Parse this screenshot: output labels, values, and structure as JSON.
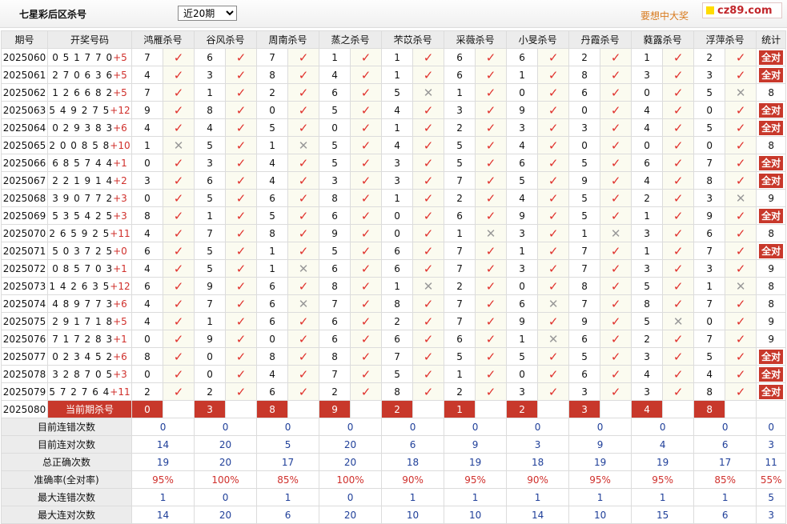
{
  "header": {
    "title": "七星彩后区杀号",
    "period_select": {
      "selected": "近20期",
      "options": [
        "近20期"
      ]
    },
    "slogan": "要想中大奖",
    "logo_text": "cz89.com"
  },
  "table": {
    "issue_header": "期号",
    "draw_header": "开奖号码",
    "summary_header": "统计",
    "experts": [
      "鸿雁杀号",
      "谷风杀号",
      "周南杀号",
      "蒸之杀号",
      "芣苡杀号",
      "采薇杀号",
      "小旻杀号",
      "丹霞杀号",
      "蕤露杀号",
      "浮萍杀号"
    ],
    "rows": [
      {
        "issue": "2025060",
        "draw": "051770",
        "plus": "+5",
        "kills": [
          7,
          6,
          7,
          1,
          1,
          6,
          6,
          2,
          1,
          2
        ],
        "hits": [
          1,
          1,
          1,
          1,
          1,
          1,
          1,
          1,
          1,
          1
        ],
        "summary": "全对"
      },
      {
        "issue": "2025061",
        "draw": "270636",
        "plus": "+5",
        "kills": [
          4,
          3,
          8,
          4,
          1,
          6,
          1,
          8,
          3,
          3
        ],
        "hits": [
          1,
          1,
          1,
          1,
          1,
          1,
          1,
          1,
          1,
          1
        ],
        "summary": "全对"
      },
      {
        "issue": "2025062",
        "draw": "126682",
        "plus": "+5",
        "kills": [
          7,
          1,
          2,
          6,
          5,
          1,
          0,
          6,
          0,
          5
        ],
        "hits": [
          1,
          1,
          1,
          1,
          0,
          1,
          1,
          1,
          1,
          0
        ],
        "summary": "8"
      },
      {
        "issue": "2025063",
        "draw": "549275",
        "plus": "+12",
        "kills": [
          9,
          8,
          0,
          5,
          4,
          3,
          9,
          0,
          4,
          0
        ],
        "hits": [
          1,
          1,
          1,
          1,
          1,
          1,
          1,
          1,
          1,
          1
        ],
        "summary": "全对"
      },
      {
        "issue": "2025064",
        "draw": "029383",
        "plus": "+6",
        "kills": [
          4,
          4,
          5,
          0,
          1,
          2,
          3,
          3,
          4,
          5
        ],
        "hits": [
          1,
          1,
          1,
          1,
          1,
          1,
          1,
          1,
          1,
          1
        ],
        "summary": "全对"
      },
      {
        "issue": "2025065",
        "draw": "200858",
        "plus": "+10",
        "kills": [
          1,
          5,
          1,
          5,
          4,
          5,
          4,
          0,
          0,
          0
        ],
        "hits": [
          0,
          1,
          0,
          1,
          1,
          1,
          1,
          1,
          1,
          1
        ],
        "summary": "8"
      },
      {
        "issue": "2025066",
        "draw": "685744",
        "plus": "+1",
        "kills": [
          0,
          3,
          4,
          5,
          3,
          5,
          6,
          5,
          6,
          7
        ],
        "hits": [
          1,
          1,
          1,
          1,
          1,
          1,
          1,
          1,
          1,
          1
        ],
        "summary": "全对"
      },
      {
        "issue": "2025067",
        "draw": "221914",
        "plus": "+2",
        "kills": [
          3,
          6,
          4,
          3,
          3,
          7,
          5,
          9,
          4,
          8
        ],
        "hits": [
          1,
          1,
          1,
          1,
          1,
          1,
          1,
          1,
          1,
          1
        ],
        "summary": "全对"
      },
      {
        "issue": "2025068",
        "draw": "390772",
        "plus": "+3",
        "kills": [
          0,
          5,
          6,
          8,
          1,
          2,
          4,
          5,
          2,
          3
        ],
        "hits": [
          1,
          1,
          1,
          1,
          1,
          1,
          1,
          1,
          1,
          0
        ],
        "summary": "9"
      },
      {
        "issue": "2025069",
        "draw": "535425",
        "plus": "+3",
        "kills": [
          8,
          1,
          5,
          6,
          0,
          6,
          9,
          5,
          1,
          9
        ],
        "hits": [
          1,
          1,
          1,
          1,
          1,
          1,
          1,
          1,
          1,
          1
        ],
        "summary": "全对"
      },
      {
        "issue": "2025070",
        "draw": "265925",
        "plus": "+11",
        "kills": [
          4,
          7,
          8,
          9,
          0,
          1,
          3,
          1,
          3,
          6
        ],
        "hits": [
          1,
          1,
          1,
          1,
          1,
          0,
          1,
          0,
          1,
          1
        ],
        "summary": "8"
      },
      {
        "issue": "2025071",
        "draw": "503725",
        "plus": "+0",
        "kills": [
          6,
          5,
          1,
          5,
          6,
          7,
          1,
          7,
          1,
          7
        ],
        "hits": [
          1,
          1,
          1,
          1,
          1,
          1,
          1,
          1,
          1,
          1
        ],
        "summary": "全对"
      },
      {
        "issue": "2025072",
        "draw": "085703",
        "plus": "+1",
        "kills": [
          4,
          5,
          1,
          6,
          6,
          7,
          3,
          7,
          3,
          3
        ],
        "hits": [
          1,
          1,
          0,
          1,
          1,
          1,
          1,
          1,
          1,
          1
        ],
        "summary": "9"
      },
      {
        "issue": "2025073",
        "draw": "142635",
        "plus": "+12",
        "kills": [
          6,
          9,
          6,
          8,
          1,
          2,
          0,
          8,
          5,
          1
        ],
        "hits": [
          1,
          1,
          1,
          1,
          0,
          1,
          1,
          1,
          1,
          0
        ],
        "summary": "8"
      },
      {
        "issue": "2025074",
        "draw": "489773",
        "plus": "+6",
        "kills": [
          4,
          7,
          6,
          7,
          8,
          7,
          6,
          7,
          8,
          7
        ],
        "hits": [
          1,
          1,
          0,
          1,
          1,
          1,
          0,
          1,
          1,
          1
        ],
        "summary": "8"
      },
      {
        "issue": "2025075",
        "draw": "291718",
        "plus": "+5",
        "kills": [
          4,
          1,
          6,
          6,
          2,
          7,
          9,
          9,
          5,
          0
        ],
        "hits": [
          1,
          1,
          1,
          1,
          1,
          1,
          1,
          1,
          0,
          1
        ],
        "summary": "9"
      },
      {
        "issue": "2025076",
        "draw": "717283",
        "plus": "+1",
        "kills": [
          0,
          9,
          0,
          6,
          6,
          6,
          1,
          6,
          2,
          7
        ],
        "hits": [
          1,
          1,
          1,
          1,
          1,
          1,
          0,
          1,
          1,
          1
        ],
        "summary": "9"
      },
      {
        "issue": "2025077",
        "draw": "023452",
        "plus": "+6",
        "kills": [
          8,
          0,
          8,
          8,
          7,
          5,
          5,
          5,
          3,
          5
        ],
        "hits": [
          1,
          1,
          1,
          1,
          1,
          1,
          1,
          1,
          1,
          1
        ],
        "summary": "全对"
      },
      {
        "issue": "2025078",
        "draw": "328705",
        "plus": "+3",
        "kills": [
          0,
          0,
          4,
          7,
          5,
          1,
          0,
          6,
          4,
          4
        ],
        "hits": [
          1,
          1,
          1,
          1,
          1,
          1,
          1,
          1,
          1,
          1
        ],
        "summary": "全对"
      },
      {
        "issue": "2025079",
        "draw": "572764",
        "plus": "+11",
        "kills": [
          2,
          2,
          6,
          2,
          8,
          2,
          3,
          3,
          3,
          8
        ],
        "hits": [
          1,
          1,
          1,
          1,
          1,
          1,
          1,
          1,
          1,
          1
        ],
        "summary": "全对"
      }
    ],
    "current": {
      "issue": "2025080",
      "label": "当前期杀号",
      "kills": [
        0,
        3,
        8,
        9,
        2,
        1,
        2,
        3,
        4,
        8
      ]
    },
    "stats": [
      {
        "label": "目前连错次数",
        "values": [
          "0",
          "0",
          "0",
          "0",
          "0",
          "0",
          "0",
          "0",
          "0",
          "0"
        ],
        "summary": "0",
        "color": "blue"
      },
      {
        "label": "目前连对次数",
        "values": [
          "14",
          "20",
          "5",
          "20",
          "6",
          "9",
          "3",
          "9",
          "4",
          "6"
        ],
        "summary": "3",
        "color": "blue"
      },
      {
        "label": "总正确次数",
        "values": [
          "19",
          "20",
          "17",
          "20",
          "18",
          "19",
          "18",
          "19",
          "19",
          "17"
        ],
        "summary": "11",
        "color": "blue"
      },
      {
        "label": "准确率(全对率)",
        "values": [
          "95%",
          "100%",
          "85%",
          "100%",
          "90%",
          "95%",
          "90%",
          "95%",
          "95%",
          "85%"
        ],
        "summary": "55%",
        "color": "red"
      },
      {
        "label": "最大连错次数",
        "values": [
          "1",
          "0",
          "1",
          "0",
          "1",
          "1",
          "1",
          "1",
          "1",
          "1"
        ],
        "summary": "5",
        "color": "blue"
      },
      {
        "label": "最大连对次数",
        "values": [
          "14",
          "20",
          "6",
          "20",
          "10",
          "10",
          "14",
          "10",
          "15",
          "6"
        ],
        "summary": "3",
        "color": "blue"
      }
    ],
    "marks": {
      "hit": "✓",
      "miss": "✕"
    },
    "colors": {
      "hit": "#e0312c",
      "miss": "#999999",
      "badge": "#c8382b",
      "stat_blue": "#1f3f99",
      "stat_red": "#d0302c"
    }
  }
}
